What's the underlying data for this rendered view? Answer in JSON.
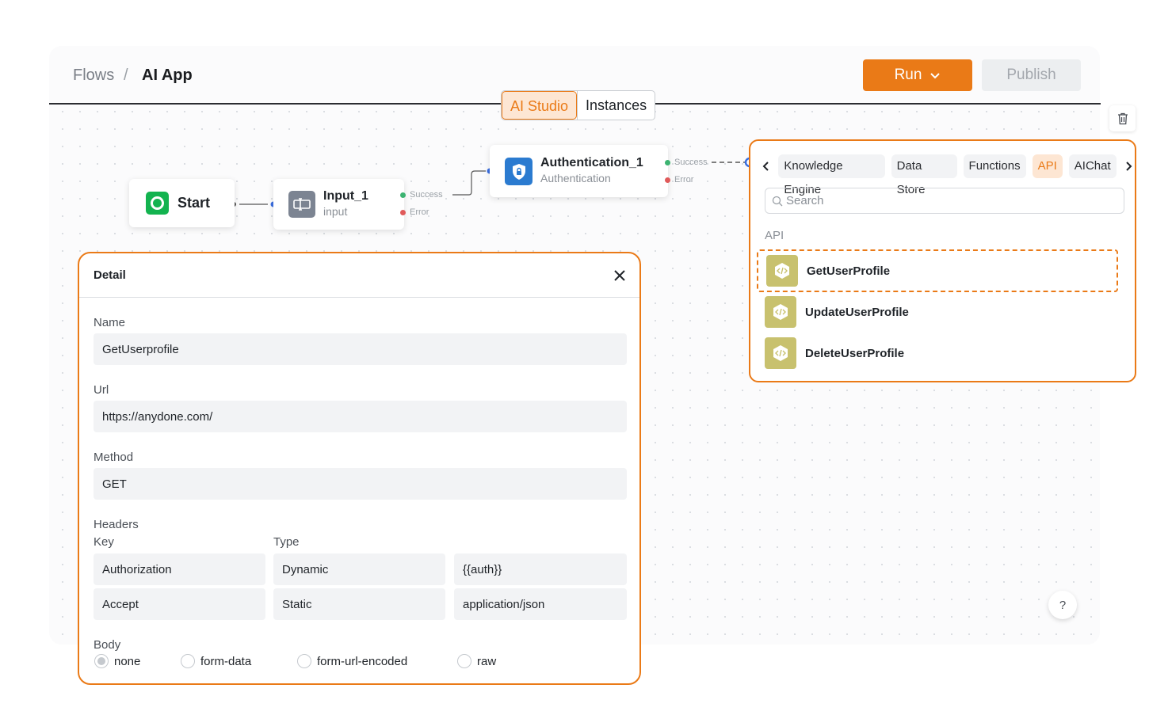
{
  "breadcrumb": {
    "root": "Flows",
    "separator": "/",
    "current": "AI App"
  },
  "toolbar": {
    "run_label": "Run",
    "publish_label": "Publish"
  },
  "mode_tabs": [
    {
      "label": "AI Studio"
    },
    {
      "label": "Instances"
    }
  ],
  "nodes": {
    "start": {
      "label": "Start"
    },
    "input": {
      "label": "Input_1",
      "subtitle": "input",
      "success": "Success",
      "error": "Error"
    },
    "auth": {
      "label": "Authentication_1",
      "subtitle": "Authentication",
      "success": "Success",
      "error": "Error"
    }
  },
  "api_panel": {
    "tabs": [
      {
        "label": "Knowledge Engine"
      },
      {
        "label": "Data Store"
      },
      {
        "label": "Functions"
      },
      {
        "label": "API"
      },
      {
        "label": "AIChat"
      }
    ],
    "search_placeholder": "Search",
    "section": "API",
    "items": [
      {
        "name": "GetUserProfile"
      },
      {
        "name": "UpdateUserProfile"
      },
      {
        "name": "DeleteUserProfile"
      }
    ]
  },
  "detail": {
    "title": "Detail",
    "name_label": "Name",
    "name_value": "GetUserprofile",
    "url_label": "Url",
    "url_value": "https://anydone.com/",
    "method_label": "Method",
    "method_value": "GET",
    "headers_label": "Headers",
    "key_col": "Key",
    "type_col": "Type",
    "headers": [
      {
        "key": "Authorization",
        "type": "Dynamic",
        "value": "{{auth}}"
      },
      {
        "key": "Accept",
        "type": "Static",
        "value": "application/json"
      }
    ],
    "body_label": "Body",
    "body_options": [
      "none",
      "form-data",
      "form-url-encoded",
      "raw"
    ],
    "body_selected": "none"
  },
  "help_label": "?",
  "colors": {
    "accent": "#ea7a17",
    "start_green": "#13b34f",
    "auth_blue": "#2b7bd0",
    "api_icon": "#c8c16e"
  }
}
